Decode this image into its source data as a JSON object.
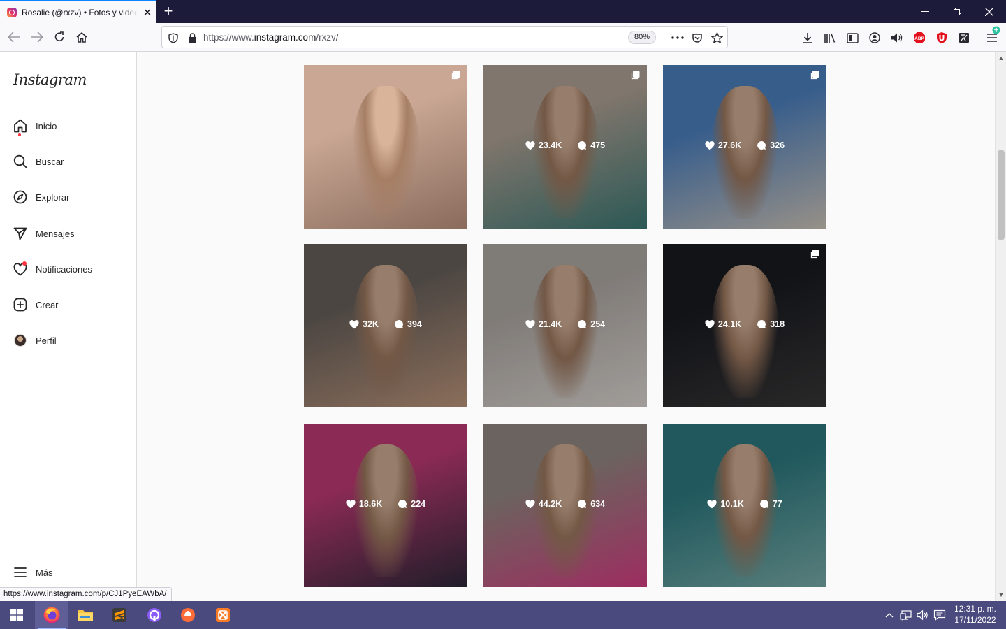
{
  "browser": {
    "tab_title": "Rosalie (@rxzv) • Fotos y videos",
    "tab_close": "✕",
    "new_tab": "+",
    "url_prefix": "https://www.",
    "url_domain": "instagram.com",
    "url_path": "/rxzv/",
    "zoom": "80%",
    "status_url": "https://www.instagram.com/p/CJ1PyeEAWbA/"
  },
  "sidebar": {
    "logo": "Instagram",
    "items": [
      {
        "label": "Inicio",
        "icon": "home-icon"
      },
      {
        "label": "Buscar",
        "icon": "search-icon"
      },
      {
        "label": "Explorar",
        "icon": "compass-icon"
      },
      {
        "label": "Mensajes",
        "icon": "send-icon"
      },
      {
        "label": "Notificaciones",
        "icon": "heart-icon"
      },
      {
        "label": "Crear",
        "icon": "plus-square-icon"
      },
      {
        "label": "Perfil",
        "icon": "avatar"
      }
    ],
    "more_label": "Más"
  },
  "posts": [
    {
      "likes": "",
      "comments": "",
      "multi": true,
      "hover": false,
      "colors": [
        "#c9a794",
        "#8a6b5c"
      ]
    },
    {
      "likes": "23.4K",
      "comments": "475",
      "multi": true,
      "hover": true,
      "colors": [
        "#b8a99c",
        "#3f7f7a"
      ]
    },
    {
      "likes": "27.6K",
      "comments": "326",
      "multi": true,
      "hover": true,
      "colors": [
        "#4f86c8",
        "#d8cfc3"
      ]
    },
    {
      "likes": "32K",
      "comments": "394",
      "multi": false,
      "hover": true,
      "colors": [
        "#6d6560",
        "#c79e82"
      ]
    },
    {
      "likes": "21.4K",
      "comments": "254",
      "multi": false,
      "hover": true,
      "colors": [
        "#b7b0ab",
        "#e7e1dc"
      ]
    },
    {
      "likes": "24.1K",
      "comments": "318",
      "multi": true,
      "hover": true,
      "colors": [
        "#1a1c22",
        "#3c3a3a"
      ]
    },
    {
      "likes": "18.6K",
      "comments": "224",
      "multi": false,
      "hover": true,
      "colors": [
        "#c83d7a",
        "#2f2a3c"
      ]
    },
    {
      "likes": "44.2K",
      "comments": "634",
      "multi": false,
      "hover": true,
      "colors": [
        "#9a8f88",
        "#e2418a"
      ]
    },
    {
      "likes": "10.1K",
      "comments": "77",
      "multi": false,
      "hover": true,
      "colors": [
        "#2e7f86",
        "#7fb5b2"
      ]
    }
  ],
  "taskbar": {
    "clock_time": "12:31 p. m.",
    "clock_date": "17/11/2022",
    "apps": [
      "windows-start-icon",
      "firefox-icon",
      "file-explorer-icon",
      "sublime-text-icon",
      "github-desktop-icon",
      "postman-icon",
      "xampp-icon"
    ]
  }
}
